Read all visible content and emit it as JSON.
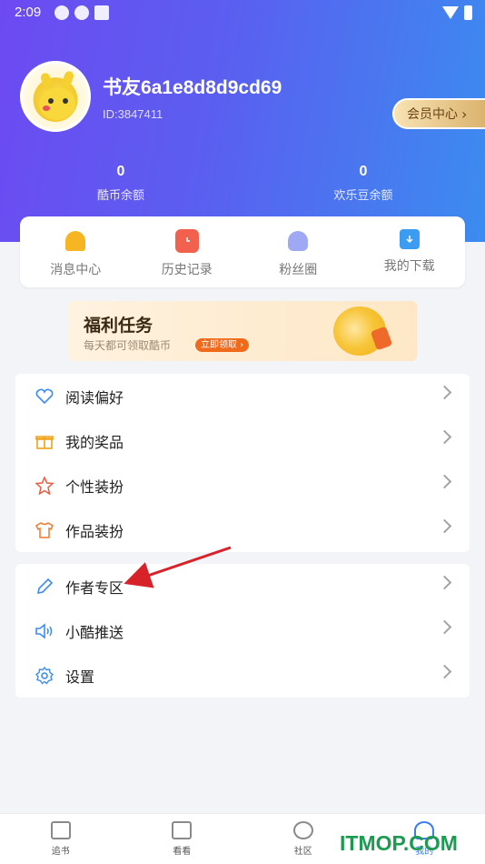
{
  "status_bar": {
    "time": "2:09"
  },
  "profile": {
    "username": "书友6a1e8d8d9cd69",
    "user_id": "ID:3847411",
    "vip_label": "会员中心",
    "vip_chevron": "›"
  },
  "stats": [
    {
      "value": "0",
      "label": "酷币余额"
    },
    {
      "value": "0",
      "label": "欢乐豆余额"
    }
  ],
  "quick_actions": [
    {
      "label": "消息中心",
      "icon": "bell-icon"
    },
    {
      "label": "历史记录",
      "icon": "history-icon"
    },
    {
      "label": "粉丝圈",
      "icon": "fans-icon"
    },
    {
      "label": "我的下载",
      "icon": "download-icon"
    }
  ],
  "banner": {
    "title": "福利任务",
    "subtitle": "每天都可领取酷币",
    "button": "立即领取 ›"
  },
  "menu_group_1": [
    {
      "label": "阅读偏好",
      "icon": "heart-icon"
    },
    {
      "label": "我的奖品",
      "icon": "gift-icon"
    },
    {
      "label": "个性装扮",
      "icon": "star-icon"
    },
    {
      "label": "作品装扮",
      "icon": "shirt-icon"
    }
  ],
  "menu_group_2": [
    {
      "label": "作者专区",
      "icon": "pencil-icon"
    },
    {
      "label": "小酷推送",
      "icon": "speaker-icon"
    },
    {
      "label": "设置",
      "icon": "gear-icon"
    }
  ],
  "bottom_nav": [
    {
      "label": "追书",
      "icon": "book-icon"
    },
    {
      "label": "看看",
      "icon": "home-icon"
    },
    {
      "label": "社区",
      "icon": "community-icon"
    },
    {
      "label": "我的",
      "icon": "person-icon",
      "active": true
    }
  ],
  "watermark": "ITMOP.COM",
  "colors": {
    "accent": "#3b7cf2",
    "gradient_start": "#6d4af2",
    "gradient_end": "#3b8cf0",
    "annotation_arrow": "#d8222a"
  }
}
